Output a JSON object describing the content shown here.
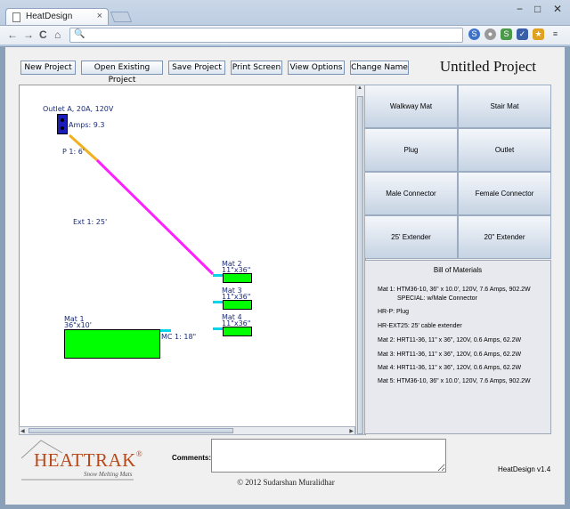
{
  "browser": {
    "tab_title": "HeatDesign",
    "tab_close": "×",
    "window_controls": [
      "−",
      "□",
      "✕"
    ],
    "nav": {
      "back": "←",
      "forward": "→",
      "reload": "C",
      "home": "⌂"
    },
    "url": ""
  },
  "toolbar": {
    "buttons": [
      "New Project",
      "Open Existing Project",
      "Save Project",
      "Print Screen",
      "View Options",
      "Change Name"
    ],
    "project_title": "Untitled Project"
  },
  "canvas": {
    "outlet_label": "Outlet A, 20A, 120V",
    "amps": "Amps: 9.3",
    "plug_label": "P 1: 6'",
    "extender_label": "Ext 1: 25'",
    "mats": [
      {
        "label": "Mat 1",
        "size": "36\"x10'"
      },
      {
        "label": "Mat 2",
        "size": "11\"x36\""
      },
      {
        "label": "Mat 3",
        "size": "11\"x36\""
      },
      {
        "label": "Mat 4",
        "size": "11\"x36\""
      }
    ],
    "mc_label": "MC 1: 18\"",
    "colors": {
      "plug_cable": "#f0b020",
      "extender_cable": "#ff20ff",
      "mat_fill": "#00ff00",
      "outlet": "#1c1cbb",
      "connector": "#00d4e8"
    }
  },
  "palette": {
    "parts": [
      "Walkway Mat",
      "Stair Mat",
      "Plug",
      "Outlet",
      "Male Connector",
      "Female Connector",
      "25' Extender",
      "20\" Extender"
    ]
  },
  "bom": {
    "title": "Bill of Materials",
    "lines": [
      "Mat 1: HTM36-10, 36\" x 10.0', 120V, 7.6 Amps, 902.2W",
      "SPECIAL: w/Male Connector",
      "HR-P: Plug",
      "HR-EXT25: 25' cable extender",
      "Mat 2: HRT11-36, 11\" x 36\", 120V, 0.6 Amps, 62.2W",
      "Mat 3: HRT11-36, 11\" x 36\", 120V, 0.6 Amps, 62.2W",
      "Mat 4: HRT11-36, 11\" x 36\", 120V, 0.6 Amps, 62.2W",
      "Mat 5: HTM36-10, 36\" x 10.0', 120V, 7.6 Amps, 902.2W"
    ]
  },
  "footer": {
    "logo_main": "HEATTRAK",
    "logo_reg": "®",
    "logo_tagline": "Snow Melting Mats",
    "comments_label": "Comments:",
    "version": "HeatDesign v1.4",
    "copyright": "© 2012 Sudarshan Muralidhar"
  }
}
